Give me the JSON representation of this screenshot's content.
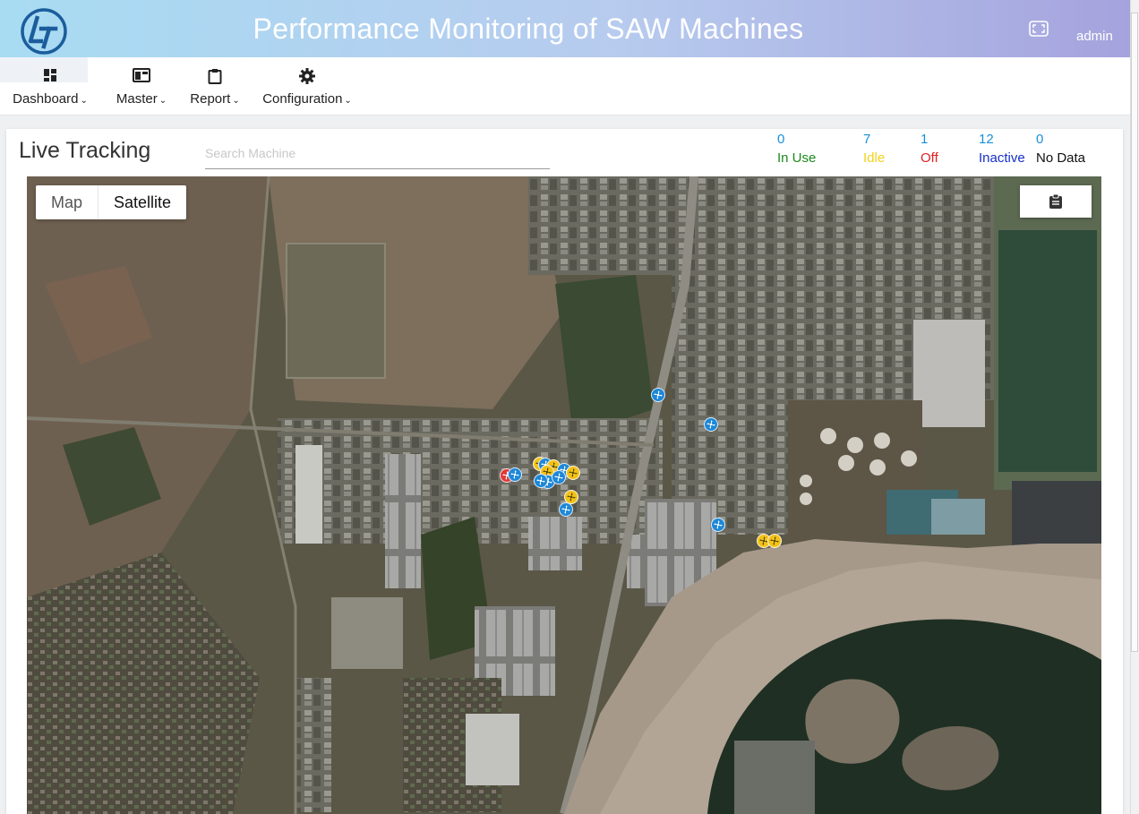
{
  "header": {
    "title": "Performance Monitoring of SAW Machines",
    "user": "admin",
    "logo_icon": "lt-logo-icon",
    "fullscreen_icon": "fullscreen-icon"
  },
  "nav": {
    "items": [
      {
        "label": "Dashboard",
        "icon": "dashboard-icon"
      },
      {
        "label": "Master",
        "icon": "master-icon"
      },
      {
        "label": "Report",
        "icon": "clipboard-icon"
      },
      {
        "label": "Configuration",
        "icon": "gear-icon"
      }
    ]
  },
  "page": {
    "title": "Live Tracking",
    "search_placeholder": "Search Machine"
  },
  "status": [
    {
      "count": "0",
      "label": "In Use",
      "color": "#1b8a1b"
    },
    {
      "count": "7",
      "label": "Idle",
      "color": "#f2d21a"
    },
    {
      "count": "1",
      "label": "Off",
      "color": "#e02020"
    },
    {
      "count": "12",
      "label": "Inactive",
      "color": "#1530c8"
    },
    {
      "count": "0",
      "label": "No Data",
      "color": "#111111"
    }
  ],
  "map": {
    "type_options": [
      "Map",
      "Satellite"
    ],
    "selected_type": "Satellite",
    "report_icon": "clipboard-icon",
    "marker_icon": "fan-icon",
    "marker_colors": {
      "idle": "#f2c21a",
      "off": "#e03a3a",
      "inactive": "#1e88d8"
    }
  }
}
